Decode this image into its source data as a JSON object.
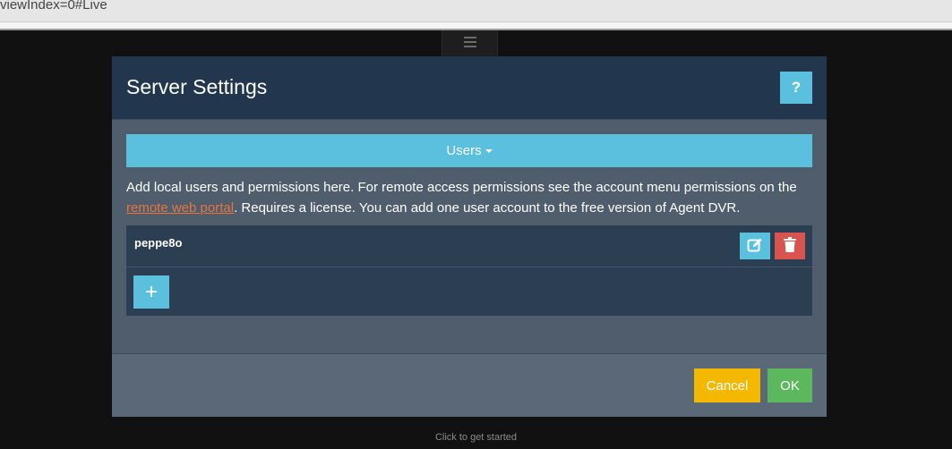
{
  "browser": {
    "url_fragment": "viewIndex=0#Live"
  },
  "modal": {
    "title": "Server Settings",
    "help_label": "?",
    "tab_label": "Users",
    "description_before": "Add local users and permissions here. For remote access permissions see the account menu permissions on the ",
    "description_link": "remote web portal",
    "description_after": ". Requires a license. You can add one user account to the free version of Agent DVR.",
    "users": [
      {
        "name": "peppe8o"
      }
    ],
    "add_label": "+",
    "cancel_label": "Cancel",
    "ok_label": "OK"
  },
  "footer_hint": "Click to get started",
  "colors": {
    "accent": "#5bc0de",
    "danger": "#d9534f",
    "warning": "#f5b800",
    "success": "#5cb85c",
    "header": "#22374e",
    "body": "#4f5d6d"
  }
}
